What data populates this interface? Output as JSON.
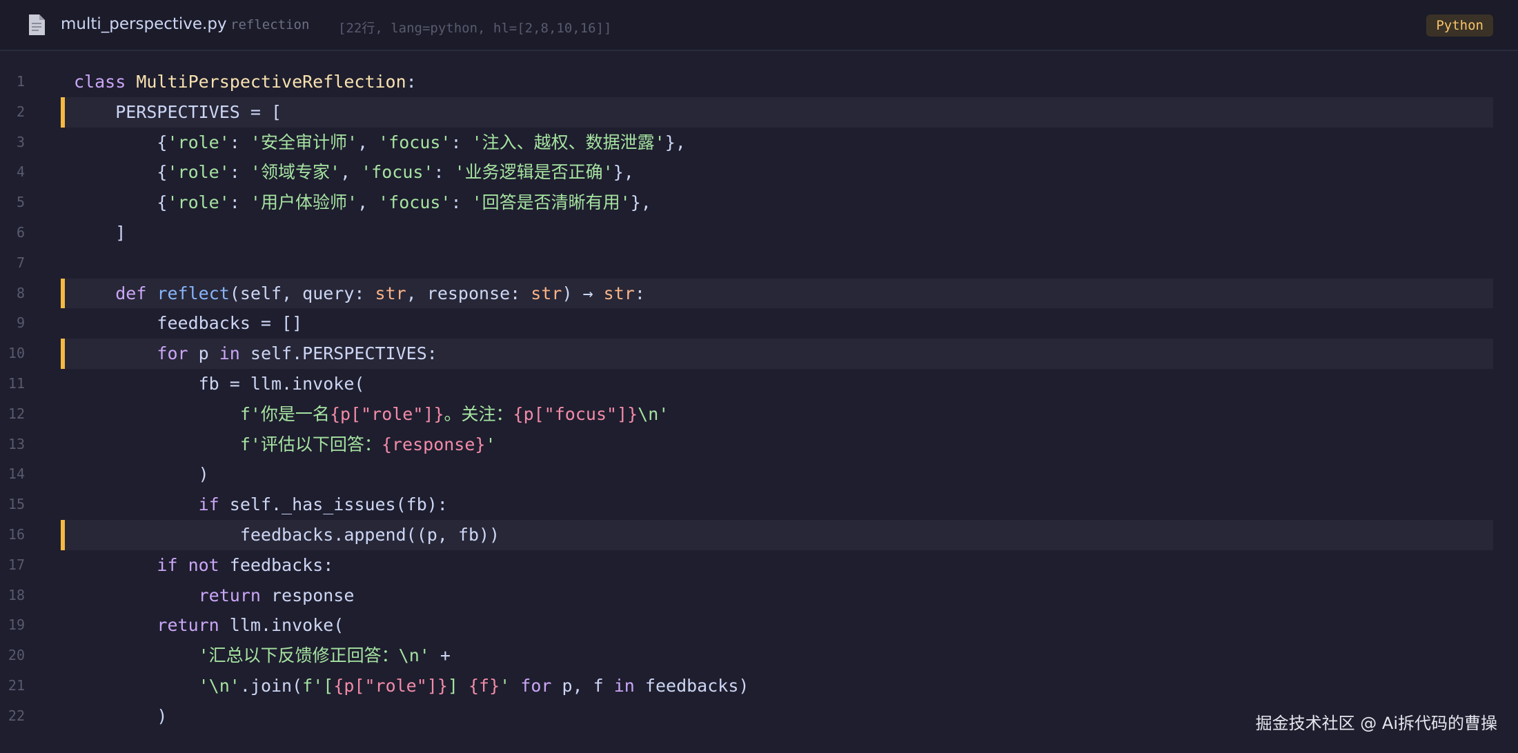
{
  "header": {
    "file_name": "multi_perspective.py",
    "tag": "reflection",
    "meta": "[22行, lang=python, hl=[2,8,10,16]]",
    "language_badge": "Python",
    "file_icon": "document-icon"
  },
  "highlighted_lines": [
    2,
    8,
    10,
    16
  ],
  "colors": {
    "background": "#1e1e2e",
    "highlight_bar": "#f5b942",
    "keyword": "#cba6f7",
    "string": "#a6e3a1",
    "class_name": "#f9e2af",
    "function_name": "#89b4fa",
    "type": "#fab387"
  },
  "code_lines": [
    [
      [
        "kw",
        "class "
      ],
      [
        "cls",
        "MultiPerspectiveReflection"
      ],
      [
        "pl",
        ":"
      ]
    ],
    [
      [
        "pl",
        "    PERSPECTIVES = ["
      ]
    ],
    [
      [
        "pl",
        "        {"
      ],
      [
        "st",
        "'role'"
      ],
      [
        "pl",
        ": "
      ],
      [
        "st",
        "'安全审计师'"
      ],
      [
        "pl",
        ", "
      ],
      [
        "st",
        "'focus'"
      ],
      [
        "pl",
        ": "
      ],
      [
        "st",
        "'注入、越权、数据泄露'"
      ],
      [
        "pl",
        "},"
      ]
    ],
    [
      [
        "pl",
        "        {"
      ],
      [
        "st",
        "'role'"
      ],
      [
        "pl",
        ": "
      ],
      [
        "st",
        "'领域专家'"
      ],
      [
        "pl",
        ", "
      ],
      [
        "st",
        "'focus'"
      ],
      [
        "pl",
        ": "
      ],
      [
        "st",
        "'业务逻辑是否正确'"
      ],
      [
        "pl",
        "},"
      ]
    ],
    [
      [
        "pl",
        "        {"
      ],
      [
        "st",
        "'role'"
      ],
      [
        "pl",
        ": "
      ],
      [
        "st",
        "'用户体验师'"
      ],
      [
        "pl",
        ", "
      ],
      [
        "st",
        "'focus'"
      ],
      [
        "pl",
        ": "
      ],
      [
        "st",
        "'回答是否清晰有用'"
      ],
      [
        "pl",
        "},"
      ]
    ],
    [
      [
        "pl",
        "    ]"
      ]
    ],
    [
      [
        "pl",
        ""
      ]
    ],
    [
      [
        "pl",
        "    "
      ],
      [
        "kw",
        "def "
      ],
      [
        "fn",
        "reflect"
      ],
      [
        "pl",
        "(self, query: "
      ],
      [
        "ty",
        "str"
      ],
      [
        "pl",
        ", response: "
      ],
      [
        "ty",
        "str"
      ],
      [
        "pl",
        ") → "
      ],
      [
        "ty",
        "str"
      ],
      [
        "pl",
        ":"
      ]
    ],
    [
      [
        "pl",
        "        feedbacks = []"
      ]
    ],
    [
      [
        "pl",
        "        "
      ],
      [
        "kw",
        "for"
      ],
      [
        "pl",
        " p "
      ],
      [
        "kw",
        "in"
      ],
      [
        "pl",
        " self.PERSPECTIVES:"
      ]
    ],
    [
      [
        "pl",
        "            fb = llm.invoke("
      ]
    ],
    [
      [
        "pl",
        "                "
      ],
      [
        "st",
        "f'你是一名"
      ],
      [
        "in",
        "{p[\"role\"]}"
      ],
      [
        "st",
        "。关注："
      ],
      [
        "in",
        "{p[\"focus\"]}"
      ],
      [
        "st",
        "\\n'"
      ]
    ],
    [
      [
        "pl",
        "                "
      ],
      [
        "st",
        "f'评估以下回答："
      ],
      [
        "in",
        "{response}"
      ],
      [
        "st",
        "'"
      ]
    ],
    [
      [
        "pl",
        "            )"
      ]
    ],
    [
      [
        "pl",
        "            "
      ],
      [
        "kw",
        "if"
      ],
      [
        "pl",
        " self._has_issues(fb):"
      ]
    ],
    [
      [
        "pl",
        "                feedbacks.append((p, fb))"
      ]
    ],
    [
      [
        "pl",
        "        "
      ],
      [
        "kw",
        "if not"
      ],
      [
        "pl",
        " feedbacks:"
      ]
    ],
    [
      [
        "pl",
        "            "
      ],
      [
        "kw",
        "return"
      ],
      [
        "pl",
        " response"
      ]
    ],
    [
      [
        "pl",
        "        "
      ],
      [
        "kw",
        "return"
      ],
      [
        "pl",
        " llm.invoke("
      ]
    ],
    [
      [
        "pl",
        "            "
      ],
      [
        "st",
        "'汇总以下反馈修正回答：\\n'"
      ],
      [
        "pl",
        " +"
      ]
    ],
    [
      [
        "pl",
        "            "
      ],
      [
        "st",
        "'\\n'"
      ],
      [
        "pl",
        ".join("
      ],
      [
        "st",
        "f'["
      ],
      [
        "in",
        "{p[\"role\"]}"
      ],
      [
        "st",
        "] "
      ],
      [
        "in",
        "{f}"
      ],
      [
        "st",
        "'"
      ],
      [
        "pl",
        " "
      ],
      [
        "kw",
        "for"
      ],
      [
        "pl",
        " p, f "
      ],
      [
        "kw",
        "in"
      ],
      [
        "pl",
        " feedbacks)"
      ]
    ],
    [
      [
        "pl",
        "        )"
      ]
    ]
  ],
  "watermark": "掘金技术社区 @ Ai拆代码的曹操"
}
